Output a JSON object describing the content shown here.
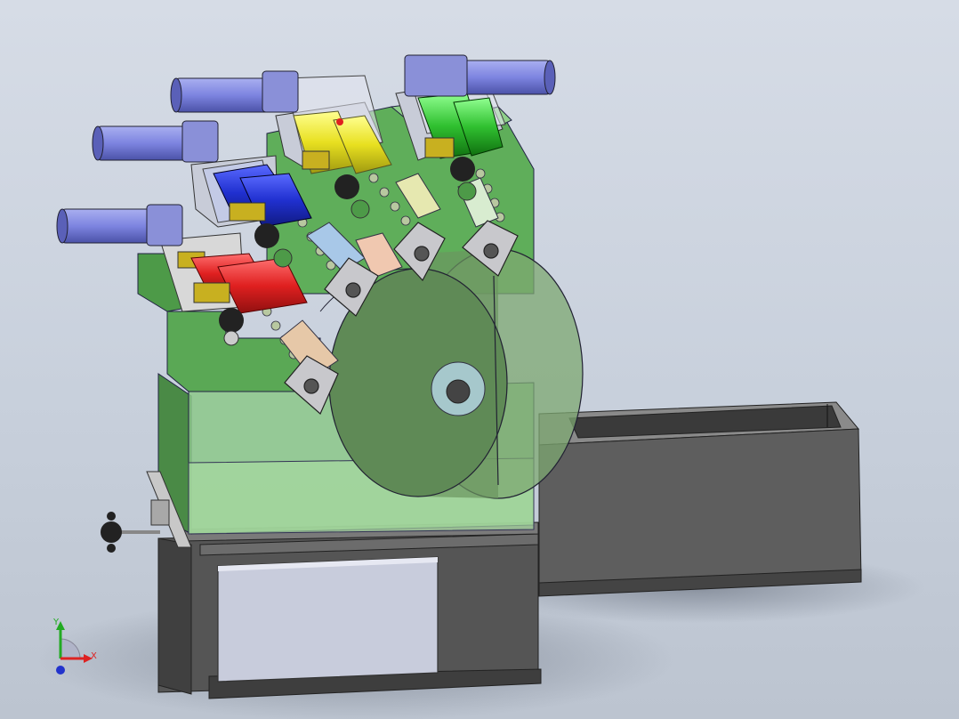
{
  "triad": {
    "y_label": "Y",
    "x_label": "X",
    "y_color": "#22aa22",
    "x_color": "#dd2222",
    "z_color": "#2233cc"
  },
  "colors": {
    "background_top": "#d6dce6",
    "background_bottom": "#bcc4d0",
    "frame_green": "#5fae5a",
    "frame_green_light": "#8fd08a",
    "base_gray": "#5c5c5c",
    "trough_gray": "#6a6a6a",
    "drum_green": "#6b8f60",
    "motor_blue": "#7d84e0",
    "roller_red": "#e03030",
    "roller_blue": "#2a3ad8",
    "roller_yellow": "#e8e030",
    "roller_green": "#30c030"
  },
  "components": [
    "base-cabinet",
    "access-door",
    "discharge-trough",
    "main-drum",
    "drum-hub",
    "green-frame",
    "feed-station-red",
    "feed-station-blue",
    "feed-station-yellow",
    "feed-station-green",
    "motor-1",
    "motor-2",
    "motor-3",
    "motor-4",
    "adjust-handwheel"
  ]
}
